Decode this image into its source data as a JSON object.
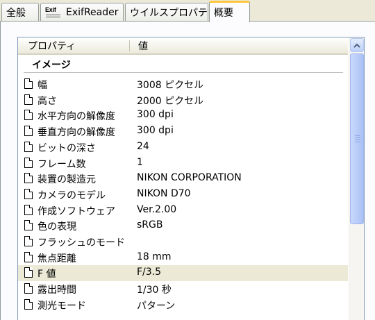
{
  "tabs": [
    {
      "label": "全般",
      "active": false
    },
    {
      "label": "ExifReader",
      "logo_text": "Exif",
      "active": false
    },
    {
      "label": "ウイルスプロパティ",
      "active": false
    },
    {
      "label": "概要",
      "active": true
    }
  ],
  "list": {
    "columns": [
      "プロパティ",
      "値"
    ],
    "group": "イメージ",
    "rows": [
      {
        "name": "幅",
        "value": "3008 ピクセル"
      },
      {
        "name": "高さ",
        "value": "2000 ピクセル"
      },
      {
        "name": "水平方向の解像度",
        "value": "300 dpi"
      },
      {
        "name": "垂直方向の解像度",
        "value": "300 dpi"
      },
      {
        "name": "ビットの深さ",
        "value": "24"
      },
      {
        "name": "フレーム数",
        "value": "1"
      },
      {
        "name": "装置の製造元",
        "value": "NIKON CORPORATION"
      },
      {
        "name": "カメラのモデル",
        "value": "NIKON D70"
      },
      {
        "name": "作成ソフトウェア",
        "value": "Ver.2.00"
      },
      {
        "name": "色の表現",
        "value": "sRGB"
      },
      {
        "name": "フラッシュのモード",
        "value": ""
      },
      {
        "name": "焦点距離",
        "value": "18 mm"
      },
      {
        "name": "F 値",
        "value": "F/3.5",
        "selected": true
      },
      {
        "name": "露出時間",
        "value": "1/30 秒"
      },
      {
        "name": "測光モード",
        "value": "パターン"
      }
    ]
  },
  "icons": {
    "row": "document-icon",
    "scroll_up": "chevron-up-icon",
    "grip": "scrollbar-grip-icon"
  },
  "colors": {
    "active_tab_accent": "#ffc83c",
    "selected_row": "#ecead6",
    "scrollbar_thumb": "#b7cbf8"
  }
}
